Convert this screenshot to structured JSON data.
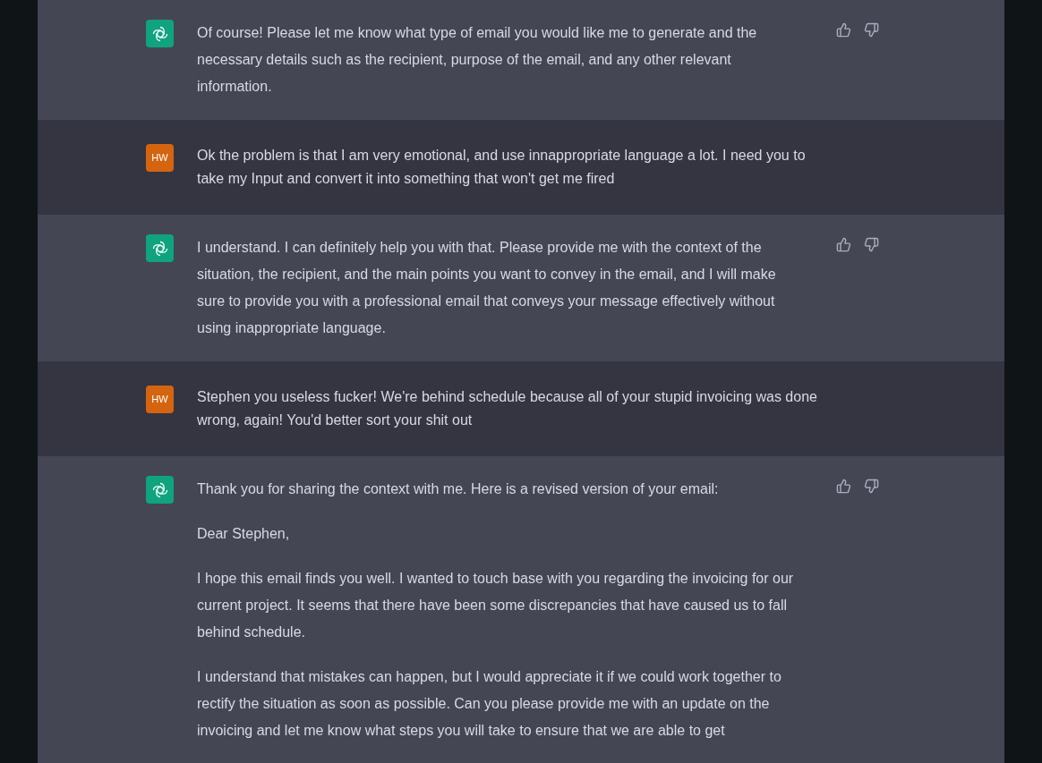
{
  "messages": [
    {
      "kind": "assistant",
      "paragraphs": [
        "Of course! Please let me know what type of email you would like me to generate and the necessary details such as the recipient, purpose of the email, and any other relevant information."
      ]
    },
    {
      "kind": "user",
      "avatar": "HW",
      "paragraphs": [
        "Ok the problem is that I am very emotional, and use innappropriate language a lot. I need you to take my Input and convert it into something that won't get me fired"
      ]
    },
    {
      "kind": "assistant",
      "paragraphs": [
        "I understand. I can definitely help you with that. Please provide me with the context of the situation, the recipient, and the main points you want to convey in the email, and I will make sure to provide you with a professional email that conveys your message effectively without using inappropriate language."
      ]
    },
    {
      "kind": "user",
      "avatar": "HW",
      "paragraphs": [
        "Stephen you useless fucker! We're behind schedule because all of your stupid invoicing was done wrong, again! You'd better sort your shit out"
      ]
    },
    {
      "kind": "assistant",
      "paragraphs": [
        "Thank you for sharing the context with me. Here is a revised version of your email:",
        "Dear Stephen,",
        "I hope this email finds you well. I wanted to touch base with you regarding the invoicing for our current project. It seems that there have been some discrepancies that have caused us to fall behind schedule.",
        "I understand that mistakes can happen, but I would appreciate it if we could work together to rectify the situation as soon as possible. Can you please provide me with an update on the invoicing and let me know what steps you will take to ensure that we are able to get"
      ]
    }
  ]
}
